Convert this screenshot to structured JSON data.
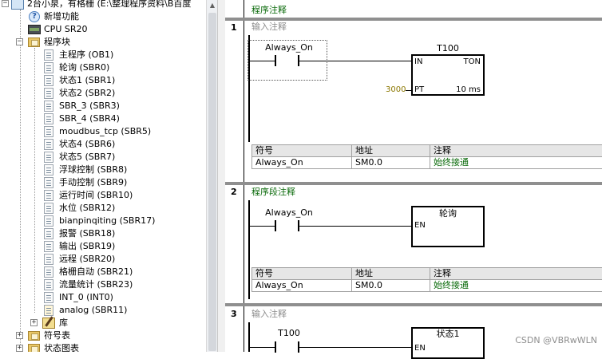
{
  "tree": {
    "top_item": "2台小泉，有格栅 (E:\\整理程序资料\\B百度",
    "items": [
      {
        "label": "新增功能",
        "icon": "help-icon"
      },
      {
        "label": "CPU SR20",
        "icon": "cpu-icon"
      },
      {
        "label": "程序块",
        "icon": "folder-icon",
        "expanded": true
      },
      {
        "label": "主程序 (OB1)",
        "icon": "program-icon"
      },
      {
        "label": "轮询 (SBR0)",
        "icon": "program-icon"
      },
      {
        "label": "状态1 (SBR1)",
        "icon": "program-icon"
      },
      {
        "label": "状态2 (SBR2)",
        "icon": "program-icon"
      },
      {
        "label": "SBR_3 (SBR3)",
        "icon": "program-icon"
      },
      {
        "label": "SBR_4 (SBR4)",
        "icon": "program-icon"
      },
      {
        "label": "moudbus_tcp (SBR5)",
        "icon": "program-icon"
      },
      {
        "label": "状态4 (SBR6)",
        "icon": "program-icon"
      },
      {
        "label": "状态5 (SBR7)",
        "icon": "program-icon"
      },
      {
        "label": "浮球控制 (SBR8)",
        "icon": "program-icon"
      },
      {
        "label": "手动控制 (SBR9)",
        "icon": "program-icon"
      },
      {
        "label": "运行时间 (SBR10)",
        "icon": "program-icon"
      },
      {
        "label": "水位 (SBR12)",
        "icon": "program-icon"
      },
      {
        "label": "bianpinqiting (SBR17)",
        "icon": "program-icon"
      },
      {
        "label": "报警 (SBR18)",
        "icon": "program-icon"
      },
      {
        "label": "输出 (SBR19)",
        "icon": "program-icon"
      },
      {
        "label": "远程 (SBR20)",
        "icon": "program-icon"
      },
      {
        "label": "格栅自动 (SBR21)",
        "icon": "program-icon"
      },
      {
        "label": "流量统计 (SBR23)",
        "icon": "program-icon"
      },
      {
        "label": "INT_0 (INT0)",
        "icon": "program-icon"
      },
      {
        "label": "analog (SBR11)",
        "icon": "locked-program-icon"
      },
      {
        "label": "库",
        "icon": "library-icon"
      },
      {
        "label": "符号表",
        "icon": "folder-icon"
      },
      {
        "label": "状态图表",
        "icon": "folder-icon"
      }
    ]
  },
  "editor": {
    "program_comment": "程序注释",
    "networks": [
      {
        "number": "1",
        "comment": "输入注释",
        "contact": "Always_On",
        "box_title": "T100",
        "box_type": "TON",
        "pin_in": "IN",
        "pin_pt": "PT",
        "pt_value": "3000",
        "timebase": "10 ms"
      },
      {
        "number": "2",
        "comment": "程序段注释",
        "contact": "Always_On",
        "box_title": "轮询",
        "pin_en": "EN"
      },
      {
        "number": "3",
        "comment": "输入注释",
        "contact": "T100",
        "box_title": "状态1",
        "pin_en": "EN"
      }
    ],
    "symbol_table": {
      "headers": [
        "符号",
        "地址",
        "注释"
      ],
      "row": [
        "Always_On",
        "SM0.0",
        "始终接通"
      ]
    }
  },
  "watermark": "CSDN @VBRwWLN",
  "colors": {
    "comment_green": "#0a6a0a",
    "pt_value": "#8b7700"
  }
}
